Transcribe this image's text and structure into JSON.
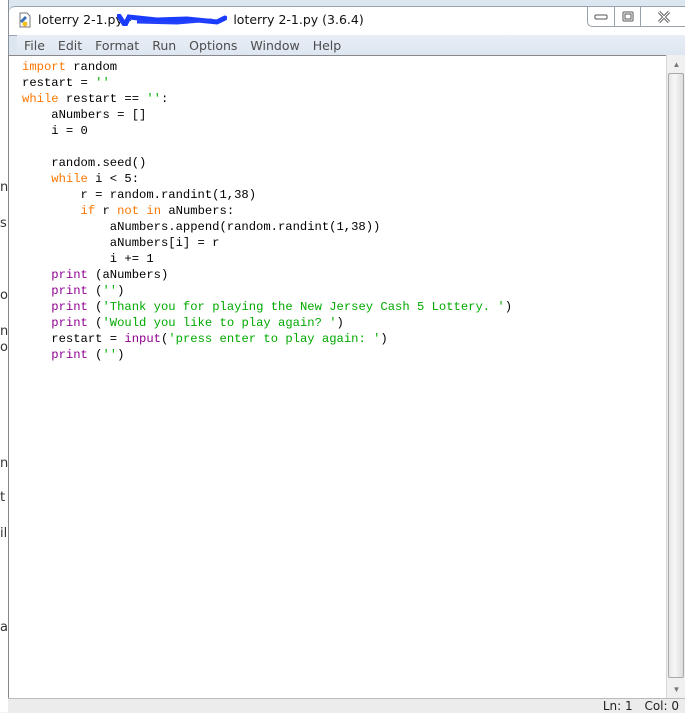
{
  "background_fragments": [
    "n",
    "s",
    "o",
    "n",
    "o",
    "n",
    "t",
    "il",
    "at"
  ],
  "window": {
    "title": "loterry 2-1.py - ",
    "title_suffix": "loterry 2-1.py (3.6.4)",
    "controls": {
      "minimize": "minimize",
      "maximize": "maximize",
      "close": "close"
    }
  },
  "menu": {
    "items": [
      "File",
      "Edit",
      "Format",
      "Run",
      "Options",
      "Window",
      "Help"
    ]
  },
  "editor": {
    "lines": [
      [
        {
          "t": "kw",
          "v": "import"
        },
        {
          "t": "",
          "v": " random"
        }
      ],
      [
        {
          "t": "",
          "v": "restart = "
        },
        {
          "t": "st",
          "v": "''"
        }
      ],
      [
        {
          "t": "kw",
          "v": "while"
        },
        {
          "t": "",
          "v": " restart == "
        },
        {
          "t": "st",
          "v": "''"
        },
        {
          "t": "",
          "v": ":"
        }
      ],
      [
        {
          "t": "",
          "v": "    aNumbers = []"
        }
      ],
      [
        {
          "t": "",
          "v": "    i = 0"
        }
      ],
      [
        {
          "t": "",
          "v": ""
        }
      ],
      [
        {
          "t": "",
          "v": "    random.seed()"
        }
      ],
      [
        {
          "t": "",
          "v": "    "
        },
        {
          "t": "kw",
          "v": "while"
        },
        {
          "t": "",
          "v": " i < 5:"
        }
      ],
      [
        {
          "t": "",
          "v": "        r = random.randint(1,38)"
        }
      ],
      [
        {
          "t": "",
          "v": "        "
        },
        {
          "t": "kw",
          "v": "if"
        },
        {
          "t": "",
          "v": " r "
        },
        {
          "t": "kw",
          "v": "not"
        },
        {
          "t": "",
          "v": " "
        },
        {
          "t": "kw",
          "v": "in"
        },
        {
          "t": "",
          "v": " aNumbers:"
        }
      ],
      [
        {
          "t": "",
          "v": "            aNumbers.append(random.randint(1,38))"
        }
      ],
      [
        {
          "t": "",
          "v": "            aNumbers[i] = r"
        }
      ],
      [
        {
          "t": "",
          "v": "            i += 1"
        }
      ],
      [
        {
          "t": "",
          "v": "    "
        },
        {
          "t": "bi",
          "v": "print"
        },
        {
          "t": "",
          "v": " (aNumbers)"
        }
      ],
      [
        {
          "t": "",
          "v": "    "
        },
        {
          "t": "bi",
          "v": "print"
        },
        {
          "t": "",
          "v": " ("
        },
        {
          "t": "st",
          "v": "''"
        },
        {
          "t": "",
          "v": ")"
        }
      ],
      [
        {
          "t": "",
          "v": "    "
        },
        {
          "t": "bi",
          "v": "print"
        },
        {
          "t": "",
          "v": " ("
        },
        {
          "t": "st",
          "v": "'Thank you for playing the New Jersey Cash 5 Lottery. '"
        },
        {
          "t": "",
          "v": ")"
        }
      ],
      [
        {
          "t": "",
          "v": "    "
        },
        {
          "t": "bi",
          "v": "print"
        },
        {
          "t": "",
          "v": " ("
        },
        {
          "t": "st",
          "v": "'Would you like to play again? '"
        },
        {
          "t": "",
          "v": ")"
        }
      ],
      [
        {
          "t": "",
          "v": "    restart = "
        },
        {
          "t": "bi",
          "v": "input"
        },
        {
          "t": "",
          "v": "("
        },
        {
          "t": "st",
          "v": "'press enter to play again: '"
        },
        {
          "t": "",
          "v": ")"
        }
      ],
      [
        {
          "t": "",
          "v": "    "
        },
        {
          "t": "bi",
          "v": "print"
        },
        {
          "t": "",
          "v": " ("
        },
        {
          "t": "st",
          "v": "''"
        },
        {
          "t": "",
          "v": ")"
        }
      ]
    ],
    "syntax_colors": {
      "keyword": "#ff7700",
      "builtin": "#900090",
      "string": "#00aa00",
      "default": "#000000"
    }
  },
  "status": {
    "line": "Ln: 1",
    "col": "Col: 0"
  }
}
